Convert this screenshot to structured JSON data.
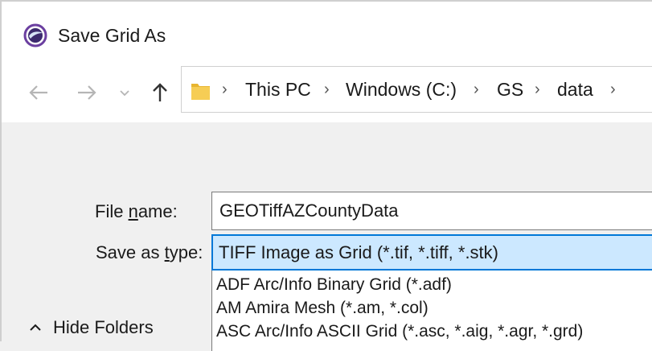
{
  "window": {
    "title": "Save Grid As",
    "app_icon": "surfer-app-icon"
  },
  "nav": {
    "back_icon": "arrow-left-icon",
    "forward_icon": "arrow-right-icon",
    "recent_icon": "chevron-down-icon",
    "up_icon": "arrow-up-icon",
    "breadcrumbs": [
      "This PC",
      "Windows (C:)",
      "GS",
      "data"
    ],
    "separator": "›"
  },
  "form": {
    "file_name_label_pre": "File ",
    "file_name_label_underline": "n",
    "file_name_label_post": "ame:",
    "file_name_value": "GEOTiffAZCountyData",
    "save_type_label_pre": "Save as ",
    "save_type_label_underline": "t",
    "save_type_label_post": "ype:",
    "save_type_value": "TIFF Image as Grid (*.tif, *.tiff, *.stk)",
    "type_options": [
      "ADF Arc/Info Binary Grid (*.adf)",
      "AM  Amira Mesh (*.am, *.col)",
      "ASC Arc/Info ASCII Grid (*.asc, *.aig, *.agr, *.grd)"
    ]
  },
  "footer": {
    "hide_folders_label": "Hide Folders",
    "hide_folders_icon": "chevron-up-icon"
  },
  "colors": {
    "accent": "#0078d7",
    "selected_bg": "#cce8ff",
    "folder": "#f4c23d"
  }
}
